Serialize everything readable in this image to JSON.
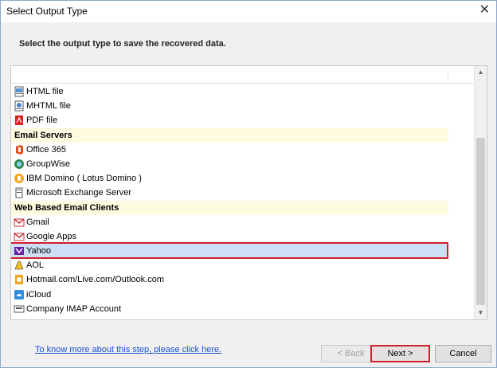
{
  "window": {
    "title": "Select Output Type",
    "close_label": "✕"
  },
  "instruction": "Select the output type to save the recovered data.",
  "list": {
    "rows": [
      {
        "type": "item",
        "label": "HTML file",
        "icon": "html-file-icon"
      },
      {
        "type": "item",
        "label": "MHTML file",
        "icon": "mhtml-file-icon"
      },
      {
        "type": "item",
        "label": "PDF file",
        "icon": "pdf-file-icon"
      },
      {
        "type": "group",
        "label": "Email Servers"
      },
      {
        "type": "item",
        "label": "Office 365",
        "icon": "office365-icon"
      },
      {
        "type": "item",
        "label": "GroupWise",
        "icon": "groupwise-icon"
      },
      {
        "type": "item",
        "label": "IBM Domino ( Lotus Domino )",
        "icon": "ibm-domino-icon"
      },
      {
        "type": "item",
        "label": "Microsoft Exchange Server",
        "icon": "exchange-server-icon"
      },
      {
        "type": "group",
        "label": "Web Based Email Clients"
      },
      {
        "type": "item",
        "label": "Gmail",
        "icon": "gmail-icon"
      },
      {
        "type": "item",
        "label": "Google Apps",
        "icon": "google-apps-icon"
      },
      {
        "type": "item",
        "label": "Yahoo",
        "icon": "yahoo-icon",
        "selected": true
      },
      {
        "type": "item",
        "label": "AOL",
        "icon": "aol-icon"
      },
      {
        "type": "item",
        "label": "Hotmail.com/Live.com/Outlook.com",
        "icon": "outlook-icon"
      },
      {
        "type": "item",
        "label": "iCloud",
        "icon": "icloud-icon"
      },
      {
        "type": "item",
        "label": "Company IMAP Account",
        "icon": "imap-icon"
      }
    ]
  },
  "footer": {
    "help_link": "To know more about this step, please click here.",
    "back_label": "< Back",
    "next_label": "Next >",
    "cancel_label": "Cancel"
  },
  "colors": {
    "highlight_outline": "#d0202a",
    "selected_row": "#cde0f5",
    "group_row": "#fffbe0",
    "link": "#1a4fd6"
  }
}
